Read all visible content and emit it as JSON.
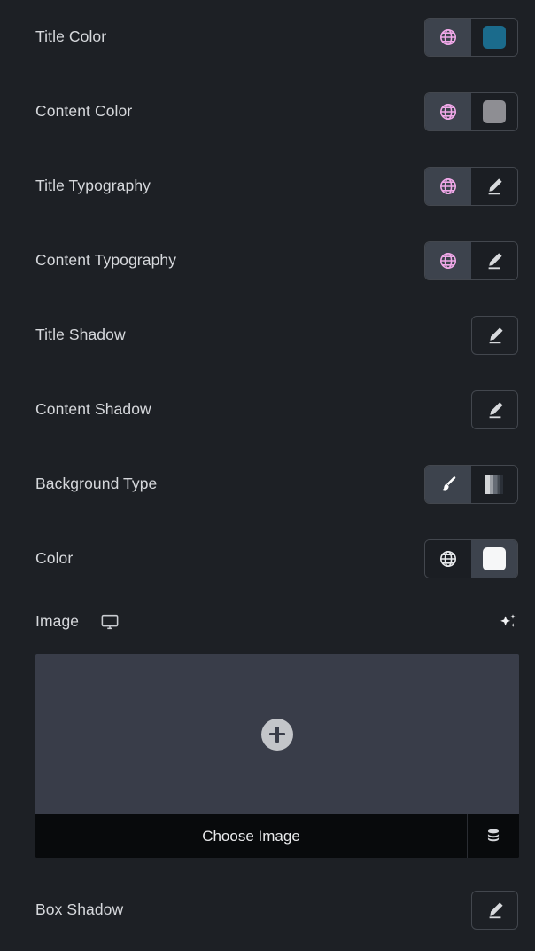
{
  "panel": {
    "background_color": "#1d2025"
  },
  "rows": [
    {
      "label": "Title Color",
      "type": "globe-swatch",
      "globe_color": "#f0a8e8",
      "active_side": "left",
      "swatch_color": "#1b6b8c"
    },
    {
      "label": "Content Color",
      "type": "globe-swatch",
      "globe_color": "#f0a8e8",
      "active_side": "left",
      "swatch_color": "#8e8e93"
    },
    {
      "label": "Title Typography",
      "type": "globe-pencil",
      "globe_color": "#f0a8e8",
      "active_side": "left"
    },
    {
      "label": "Content Typography",
      "type": "globe-pencil",
      "globe_color": "#f0a8e8",
      "active_side": "left"
    },
    {
      "label": "Title Shadow",
      "type": "pencil-only"
    },
    {
      "label": "Content Shadow",
      "type": "pencil-only"
    },
    {
      "label": "Background Type",
      "type": "brush-gradient",
      "active_side": "left"
    },
    {
      "label": "Color",
      "type": "globe-swatch",
      "globe_color": "#e8eaec",
      "active_side": "right",
      "swatch_color": "#f6f7f8"
    },
    {
      "label": "Box Shadow",
      "type": "pencil-only"
    }
  ],
  "image_section": {
    "label": "Image",
    "responsive_icon": "monitor-icon",
    "ai_icon": "sparkle-icon",
    "preview_add_icon": "plus-circle-icon",
    "choose_label": "Choose Image",
    "library_icon": "database-icon"
  },
  "icons": {
    "globe": "globe-icon",
    "pencil": "pencil-edit-icon",
    "brush": "paint-brush-icon",
    "gradient": "gradient-icon"
  }
}
